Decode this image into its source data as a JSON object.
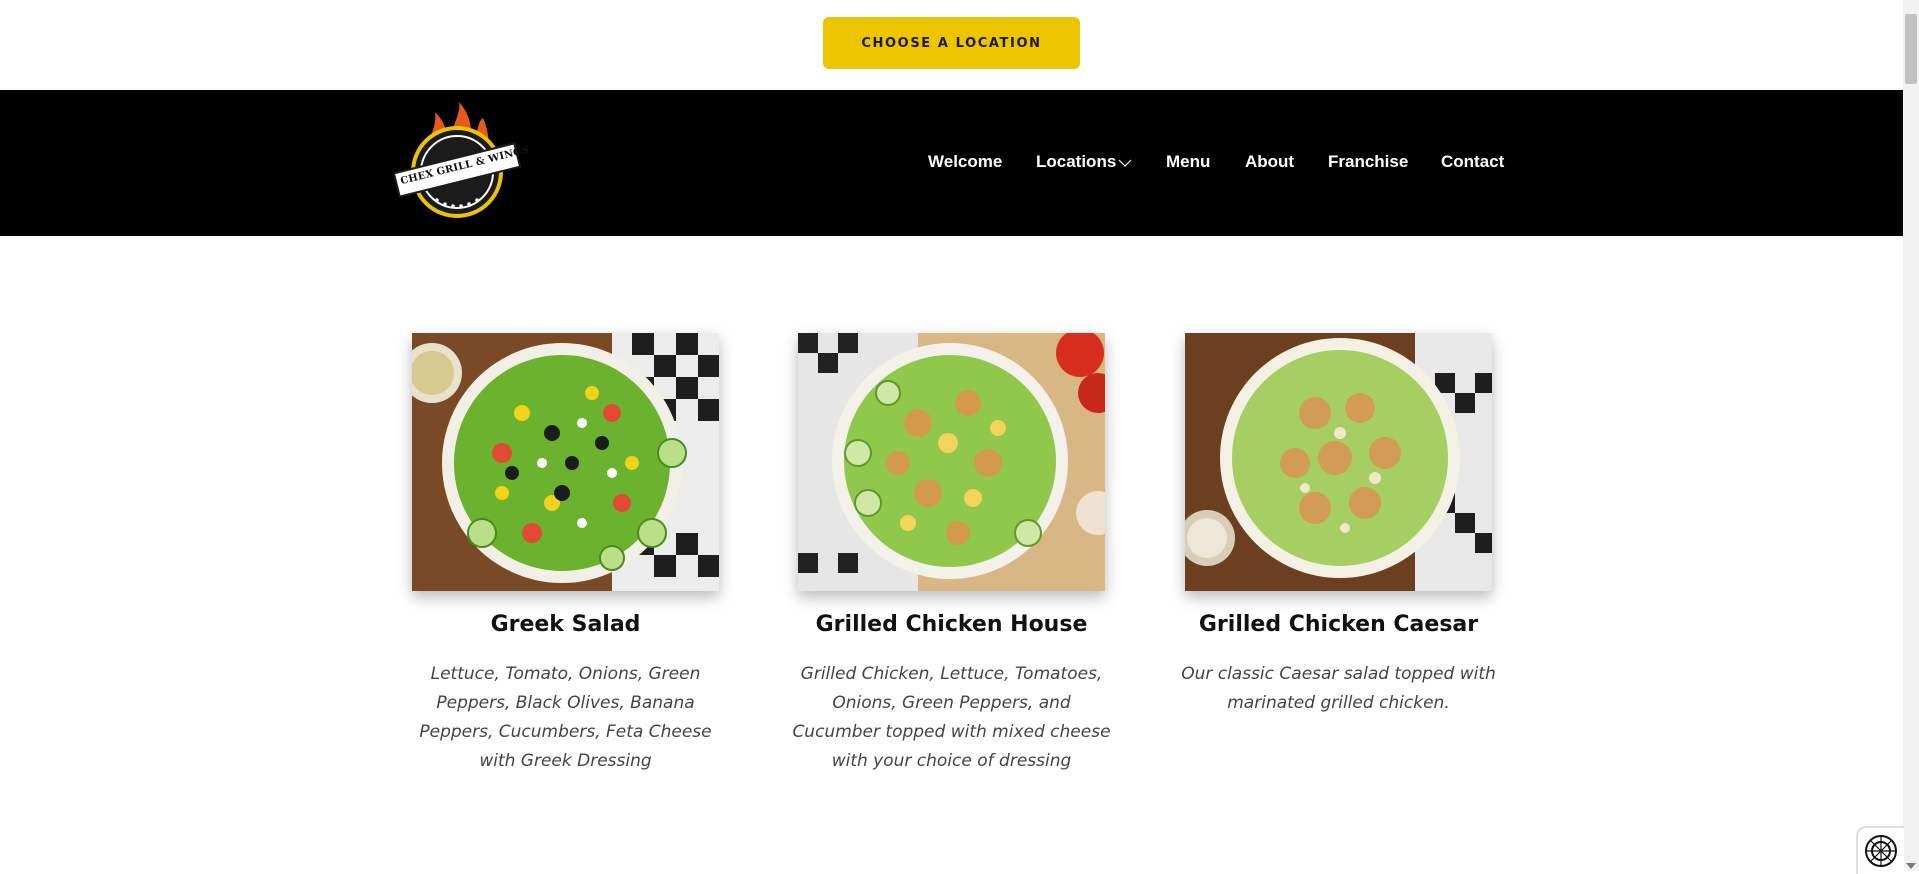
{
  "topbar": {
    "choose_location_label": "CHOOSE A LOCATION"
  },
  "brand": {
    "logo_text": "CHEX GRILL & WINGS",
    "accent": "#ecc500",
    "flame": "#e8591f"
  },
  "nav": {
    "items": [
      {
        "label": "Welcome"
      },
      {
        "label": "Locations",
        "has_dropdown": true
      },
      {
        "label": "Menu"
      },
      {
        "label": "About"
      },
      {
        "label": "Franchise"
      },
      {
        "label": "Contact"
      }
    ]
  },
  "menu_items": [
    {
      "title": "Greek Salad",
      "description": "Lettuce, Tomato, Onions, Green Peppers, Black Olives, Banana Peppers, Cucumbers, Feta Cheese with Greek Dressing"
    },
    {
      "title": "Grilled Chicken House",
      "description": "Grilled Chicken, Lettuce, Tomatoes, Onions, Green Peppers, and Cucumber topped with mixed cheese with your choice of dressing"
    },
    {
      "title": "Grilled Chicken Caesar",
      "description": "Our classic Caesar salad topped with marinated grilled chicken."
    }
  ],
  "accessibility": {
    "icon": "accessibility-icon"
  }
}
